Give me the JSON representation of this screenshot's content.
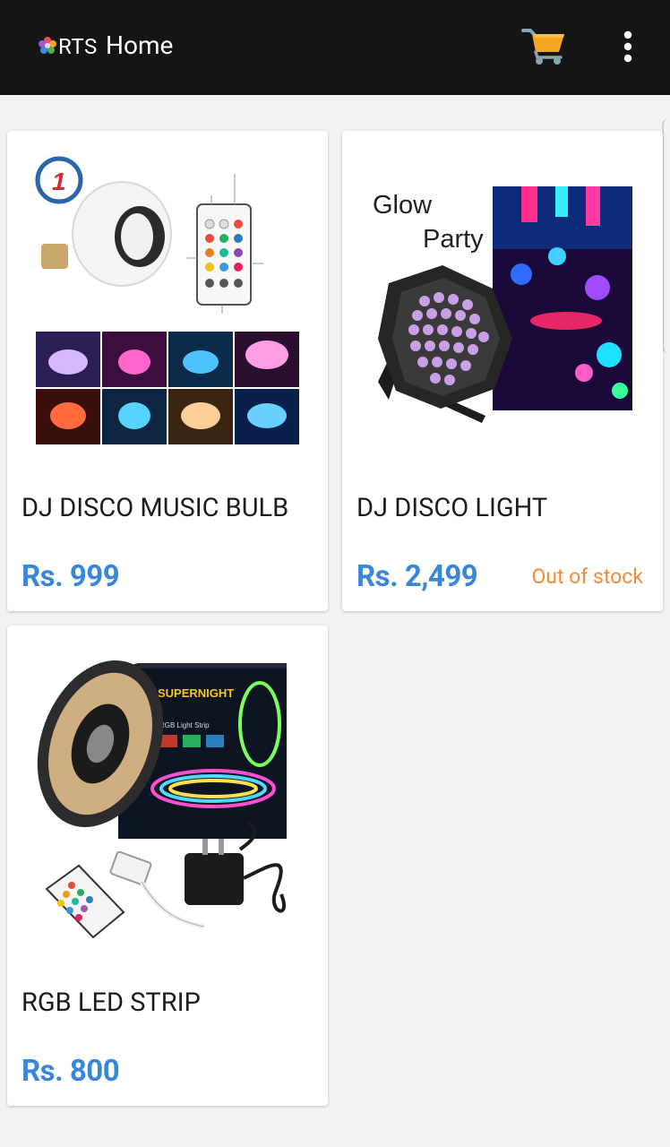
{
  "app": {
    "logo_text": "RTS",
    "title": "Home"
  },
  "icons": {
    "logo": "flower-logo-icon",
    "cart": "shopping-cart-icon",
    "menu": "more-vertical-icon"
  },
  "colors": {
    "topbar": "#151515",
    "price": "#3a86d8",
    "out_of_stock": "#ef8a3c",
    "cart": "#f5a623"
  },
  "products": [
    {
      "name": "DJ DISCO MUSIC BULB",
      "price": "Rs. 999",
      "stock": ""
    },
    {
      "name": "DJ DISCO LIGHT",
      "price": "Rs. 2,499",
      "stock": "Out of stock",
      "image_caption_1": "Glow",
      "image_caption_2": "Party"
    },
    {
      "name": "RGB LED STRIP",
      "price": "Rs. 800",
      "stock": "",
      "image_brand": "SUPERNIGHT",
      "image_caption": "RGB Light Strip"
    }
  ]
}
